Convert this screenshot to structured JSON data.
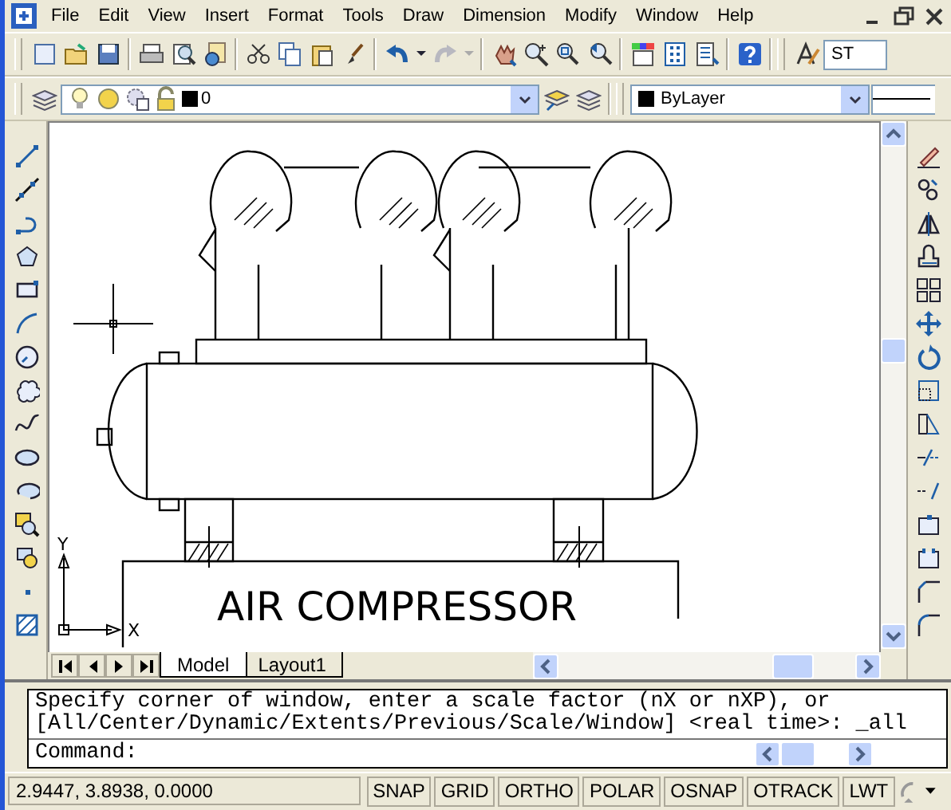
{
  "menu": [
    "File",
    "Edit",
    "View",
    "Insert",
    "Format",
    "Tools",
    "Draw",
    "Dimension",
    "Modify",
    "Window",
    "Help"
  ],
  "style_field": {
    "value": "ST"
  },
  "layer_dropdown": {
    "value": "0"
  },
  "color_dropdown": {
    "value": "ByLayer"
  },
  "drawing": {
    "title": "AIR COMPRESSOR",
    "ucs_x": "X",
    "ucs_y": "Y"
  },
  "tabs": [
    {
      "label": "Model",
      "selected": true
    },
    {
      "label": "Layout1",
      "selected": false
    }
  ],
  "command": {
    "history": [
      "Specify corner of window, enter a scale factor (nX or nXP), or",
      "[All/Center/Dynamic/Extents/Previous/Scale/Window] <real time>: _all"
    ],
    "prompt": "Command:"
  },
  "status_bar": {
    "coordinates": "2.9447, 3.8938, 0.0000",
    "toggles": [
      {
        "label": "SNAP",
        "on": false
      },
      {
        "label": "GRID",
        "on": false
      },
      {
        "label": "ORTHO",
        "on": false
      },
      {
        "label": "POLAR",
        "on": false
      },
      {
        "label": "OSNAP",
        "on": false
      },
      {
        "label": "OTRACK",
        "on": false
      },
      {
        "label": "LWT",
        "on": false
      }
    ]
  }
}
